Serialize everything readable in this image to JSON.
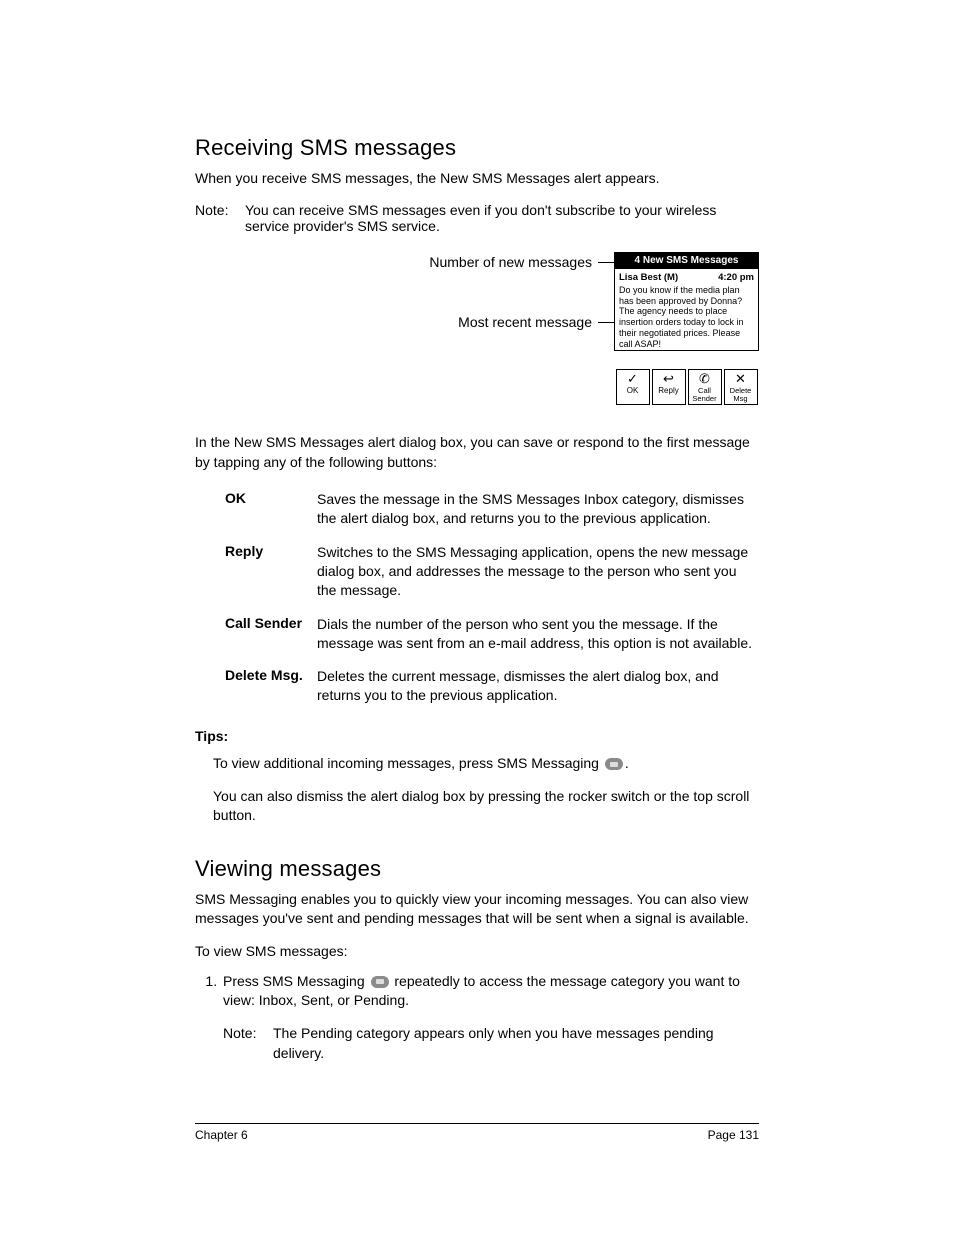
{
  "section1": {
    "heading": "Receiving SMS messages",
    "intro": "When you receive SMS messages, the New SMS Messages alert appears.",
    "note_label": "Note:",
    "note_body": "You can receive SMS messages even if you don't subscribe to your wireless service provider's SMS service.",
    "callout_top": "Number of new messages",
    "callout_mid": "Most recent message",
    "device": {
      "title": "4 New SMS Messages",
      "sender": "Lisa Best (M)",
      "time": "4:20 pm",
      "body": "Do you know if the media plan has been approved by Donna? The agency needs to place insertion orders today to lock in their negotiated prices. Please call ASAP!",
      "btn1": "OK",
      "btn2": "Reply",
      "btn3": "Call Sender",
      "btn4": "Delete Msg"
    },
    "after_diagram": "In the New SMS Messages alert dialog box, you can save or respond to the first message by tapping any of the following buttons:",
    "defs": [
      {
        "term": "OK",
        "body": "Saves the message in the SMS Messages Inbox category, dismisses the alert dialog box, and returns you to the previous application."
      },
      {
        "term": "Reply",
        "body": "Switches to the SMS Messaging application, opens the new message dialog box, and addresses the message to the person who sent you the message."
      },
      {
        "term": "Call Sender",
        "body": "Dials the number of the person who sent you the message. If the message was sent from an e-mail address, this option is not available."
      },
      {
        "term": "Delete Msg.",
        "body": "Deletes the current message, dismisses the alert dialog box, and returns you to the previous application."
      }
    ],
    "tips_heading": "Tips:",
    "tip1_a": "To view additional incoming messages, press SMS Messaging ",
    "tip1_b": ".",
    "tip2": "You can also dismiss the alert dialog box by pressing the rocker switch or the top scroll button."
  },
  "section2": {
    "heading": "Viewing messages",
    "intro": "SMS Messaging enables you to quickly view your incoming messages. You can also view messages you've sent and pending messages that will be sent when a signal is available.",
    "sub_heading": "To view SMS messages:",
    "step1_a": "Press SMS Messaging ",
    "step1_b": " repeatedly to access the message category you want to view: Inbox, Sent, or Pending.",
    "step_note_label": "Note:",
    "step_note_body": "The Pending category appears only when you have messages pending delivery."
  },
  "footer": {
    "left": "Chapter 6",
    "right": "Page 131"
  }
}
